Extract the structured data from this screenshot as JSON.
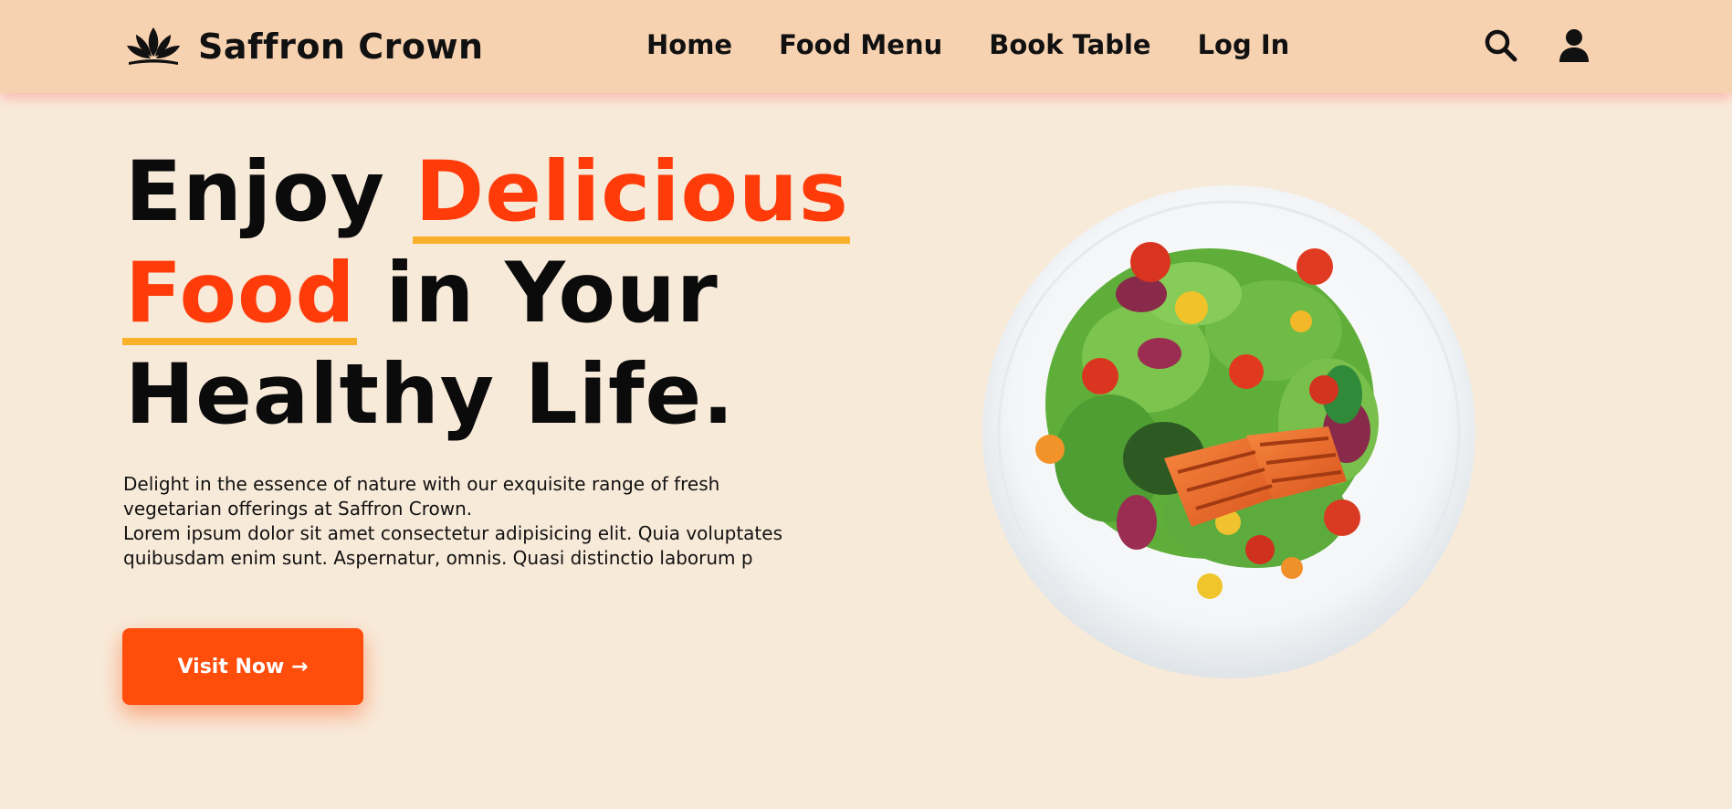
{
  "brand": {
    "name": "Saffron Crown",
    "logo_icon": "lotus-icon"
  },
  "nav": {
    "links": [
      "Home",
      "Food Menu",
      "Book Table",
      "Log In"
    ],
    "search_icon": "search-icon",
    "user_icon": "user-icon"
  },
  "hero": {
    "title_word_1": "Enjoy",
    "title_highlight_1": "Delicious",
    "title_highlight_2": "Food",
    "title_mid": "in Your",
    "title_line_3": "Healthy Life.",
    "description_line_1": "Delight in the essence of nature with our exquisite range of fresh",
    "description_line_2": "vegetarian offerings at Saffron Crown.",
    "description_line_3": "Lorem ipsum dolor sit amet consectetur adipisicing elit. Quia voluptates",
    "description_line_4": "quibusdam enim sunt. Aspernatur, omnis. Quasi distinctio laborum p",
    "cta_label": "Visit Now",
    "cta_icon": "arrow-right-icon"
  },
  "image": {
    "subject": "salmon-salad-plate"
  },
  "colors": {
    "background": "#f8ead9",
    "navbar": "#f7d2b1",
    "accent": "#ff3b0a",
    "underline": "#f9b02a",
    "button": "#ff4d0b"
  }
}
